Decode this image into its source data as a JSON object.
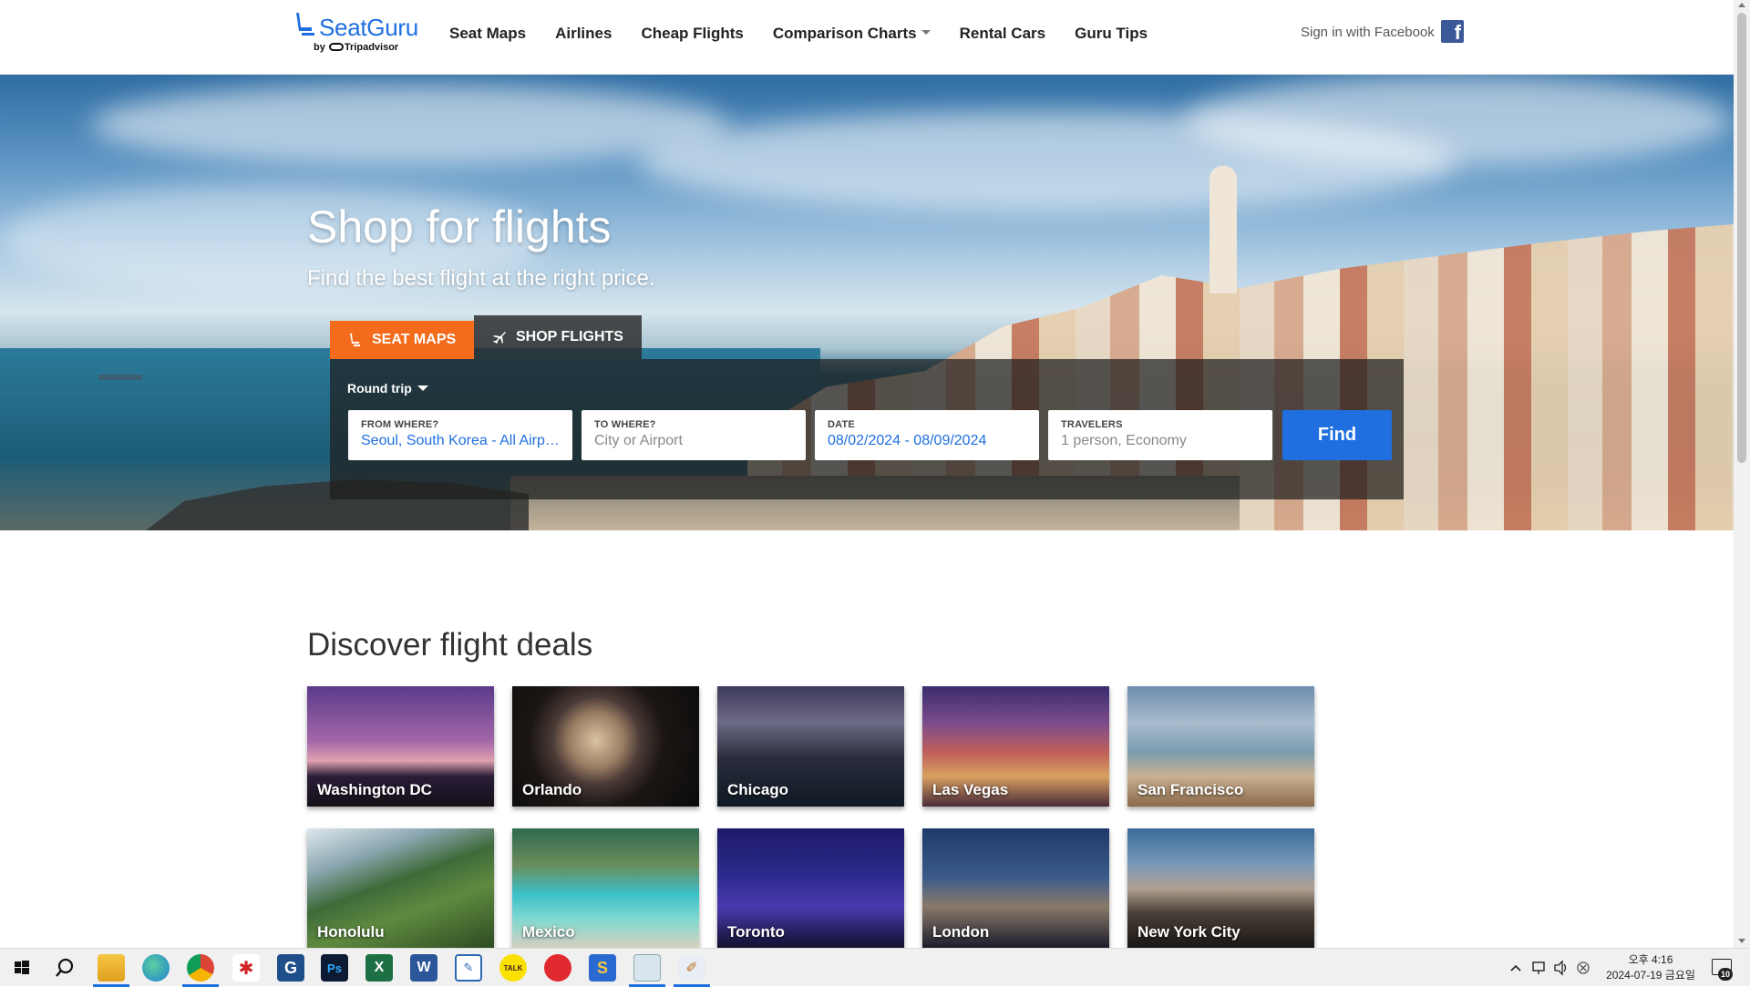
{
  "header": {
    "logo_text": "SeatGuru",
    "logo_by": "by",
    "logo_tripadvisor": "Tripadvisor",
    "nav": [
      {
        "label": "Seat Maps"
      },
      {
        "label": "Airlines"
      },
      {
        "label": "Cheap Flights"
      },
      {
        "label": "Comparison Charts",
        "has_dropdown": true
      },
      {
        "label": "Rental Cars"
      },
      {
        "label": "Guru Tips"
      }
    ],
    "signin_label": "Sign in with Facebook",
    "facebook_icon": "facebook-icon",
    "facebook_glyph": "f"
  },
  "hero": {
    "title": "Shop for flights",
    "subtitle": "Find the best flight at the right price.",
    "tabs": {
      "seat_maps": "SEAT MAPS",
      "shop_flights": "SHOP FLIGHTS"
    },
    "trip_type": "Round trip",
    "fields": {
      "from": {
        "label": "FROM WHERE?",
        "value": "Seoul, South Korea - All Airports"
      },
      "to": {
        "label": "TO WHERE?",
        "placeholder": "City or Airport"
      },
      "date": {
        "label": "DATE",
        "value": "08/02/2024 - 08/09/2024"
      },
      "travelers": {
        "label": "TRAVELERS",
        "value": "1 person, Economy"
      }
    },
    "find_label": "Find"
  },
  "deals": {
    "title": "Discover flight deals",
    "cities": [
      "Washington DC",
      "Orlando",
      "Chicago",
      "Las Vegas",
      "San Francisco",
      "Honolulu",
      "Mexico",
      "Toronto",
      "London",
      "New York City"
    ]
  },
  "taskbar": {
    "apps": [
      {
        "name": "file-explorer-icon"
      },
      {
        "name": "edge-icon"
      },
      {
        "name": "chrome-icon"
      },
      {
        "name": "app-red-icon"
      },
      {
        "name": "app-g-icon",
        "glyph": "G"
      },
      {
        "name": "photoshop-icon",
        "glyph": "Ps"
      },
      {
        "name": "excel-icon",
        "glyph": "X"
      },
      {
        "name": "word-icon",
        "glyph": "W"
      },
      {
        "name": "app-chart-icon"
      },
      {
        "name": "kakaotalk-icon",
        "glyph": "TALK"
      },
      {
        "name": "app-circle-red-icon"
      },
      {
        "name": "app-s-icon",
        "glyph": "S"
      },
      {
        "name": "app-window-icon"
      },
      {
        "name": "app-brush-icon"
      }
    ],
    "time": "오후 4:16",
    "date": "2024-07-19 금요일",
    "notification_count": "10"
  }
}
